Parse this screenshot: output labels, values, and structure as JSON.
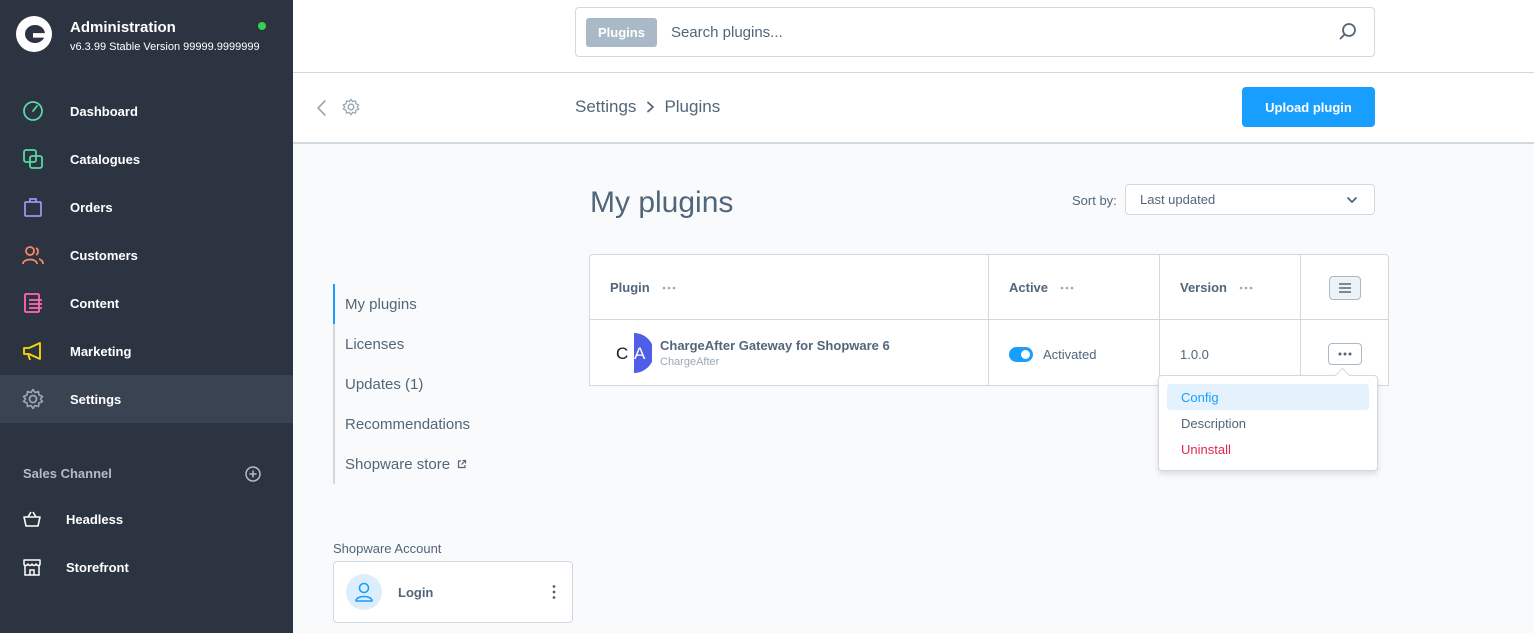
{
  "brand": {
    "title": "Administration",
    "version": "v6.3.99 Stable Version 99999.9999999"
  },
  "nav": {
    "items": [
      {
        "label": "Dashboard",
        "icon": "dashboard-icon",
        "color": "#57d9a3"
      },
      {
        "label": "Catalogues",
        "icon": "catalogues-icon",
        "color": "#57d9a3"
      },
      {
        "label": "Orders",
        "icon": "orders-icon",
        "color": "#a092f0"
      },
      {
        "label": "Customers",
        "icon": "customers-icon",
        "color": "#f88962"
      },
      {
        "label": "Content",
        "icon": "content-icon",
        "color": "#ff68b4"
      },
      {
        "label": "Marketing",
        "icon": "marketing-icon",
        "color": "#ffd700"
      },
      {
        "label": "Settings",
        "icon": "settings-icon",
        "color": "#9aa8b5"
      }
    ]
  },
  "sales_channel": {
    "title": "Sales Channel",
    "items": [
      {
        "label": "Headless",
        "icon": "basket-icon"
      },
      {
        "label": "Storefront",
        "icon": "storefront-icon"
      }
    ]
  },
  "search": {
    "type_label": "Plugins",
    "placeholder": "Search plugins..."
  },
  "breadcrumb": {
    "parent": "Settings",
    "current": "Plugins"
  },
  "upload_button": "Upload plugin",
  "page_title": "My plugins",
  "sort": {
    "label": "Sort by:",
    "value": "Last updated"
  },
  "subnav": {
    "items": [
      {
        "label": "My plugins"
      },
      {
        "label": "Licenses"
      },
      {
        "label": "Updates (1)"
      },
      {
        "label": "Recommendations"
      },
      {
        "label": "Shopware store"
      }
    ]
  },
  "account": {
    "label": "Shopware Account",
    "login": "Login"
  },
  "grid": {
    "columns": [
      "Plugin",
      "Active",
      "Version"
    ],
    "rows": [
      {
        "logo_text": "CA",
        "name": "ChargeAfter Gateway for Shopware 6",
        "vendor": "ChargeAfter",
        "active_label": "Activated",
        "active": true,
        "version": "1.0.0"
      }
    ]
  },
  "context_menu": {
    "items": [
      "Config",
      "Description",
      "Uninstall"
    ]
  },
  "colors": {
    "accent": "#189eff",
    "sidebar": "#2c3441",
    "danger": "#de294c"
  }
}
